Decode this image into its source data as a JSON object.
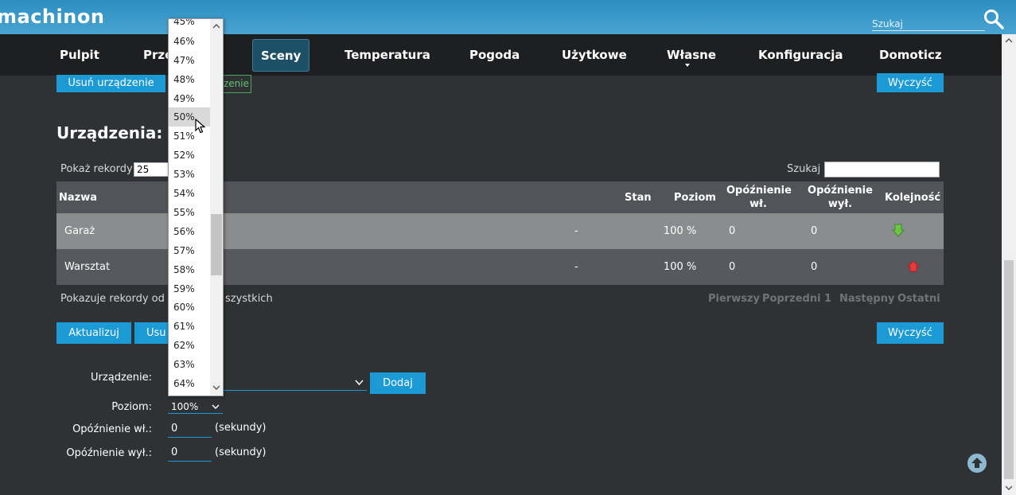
{
  "header": {
    "logo": "machinon",
    "search_placeholder": "Szukaj"
  },
  "nav": {
    "items": [
      "Pulpit",
      "Prze",
      "Sceny",
      "Temperatura",
      "Pogoda",
      "Użytkowe",
      "Własne",
      "Konfiguracja",
      "Domoticz"
    ],
    "active": "Sceny"
  },
  "top_buttons": {
    "remove_device": "Usuń urządzenie",
    "add_device_partial": "zenie",
    "clear": "Wyczyść"
  },
  "devices": {
    "heading": "Urządzenia:",
    "show_label": "Pokaż rekordy",
    "records_value": "25",
    "search_label": "Szukaj :",
    "columns": [
      "Nazwa",
      "Stan",
      "Poziom",
      "Opóźnienie wł.",
      "Opóźnienie wył.",
      "Kolejność"
    ],
    "rows": [
      {
        "name": "Garaż",
        "state": "-",
        "level": "100 %",
        "on_delay": "0",
        "off_delay": "0",
        "order_icon": "arrow-down-icon"
      },
      {
        "name": "Warsztat",
        "state": "-",
        "level": "100 %",
        "on_delay": "0",
        "off_delay": "0",
        "order_icon": "arrow-up-icon"
      }
    ],
    "info_left": "Pokazuje rekordy od 1",
    "info_right": "szystkich",
    "pager": [
      "Pierwszy",
      "Poprzedni",
      "1",
      "Następny",
      "Ostatni"
    ]
  },
  "bottom_buttons": {
    "update": "Aktualizuj",
    "remove_partial": "Usu",
    "clear": "Wyczyść"
  },
  "form": {
    "device_label": "Urządzenie:",
    "add_button": "Dodaj",
    "level_label": "Poziom:",
    "level_value": "100%",
    "on_delay_label": "Opóźnienie wł.:",
    "on_delay_value": "0",
    "off_delay_label": "Opóźnienie wył.:",
    "off_delay_value": "0",
    "seconds_hint": "(sekundy)"
  },
  "dropdown": {
    "partial_top": "45%",
    "options": [
      "46%",
      "47%",
      "48%",
      "49%",
      "50%",
      "51%",
      "52%",
      "53%",
      "54%",
      "55%",
      "56%",
      "57%",
      "58%",
      "59%",
      "60%",
      "61%",
      "62%",
      "63%",
      "64%"
    ],
    "highlighted": "50%"
  },
  "colors": {
    "accent": "#1b9ad6",
    "header": "#3a99c9",
    "navbar": "#1e1f20",
    "background": "#2f3235",
    "row_highlight": "#8a8c8e",
    "row_normal": "#565a5e",
    "arrow_down": "#6cc644",
    "arrow_up": "#e83b3b"
  }
}
